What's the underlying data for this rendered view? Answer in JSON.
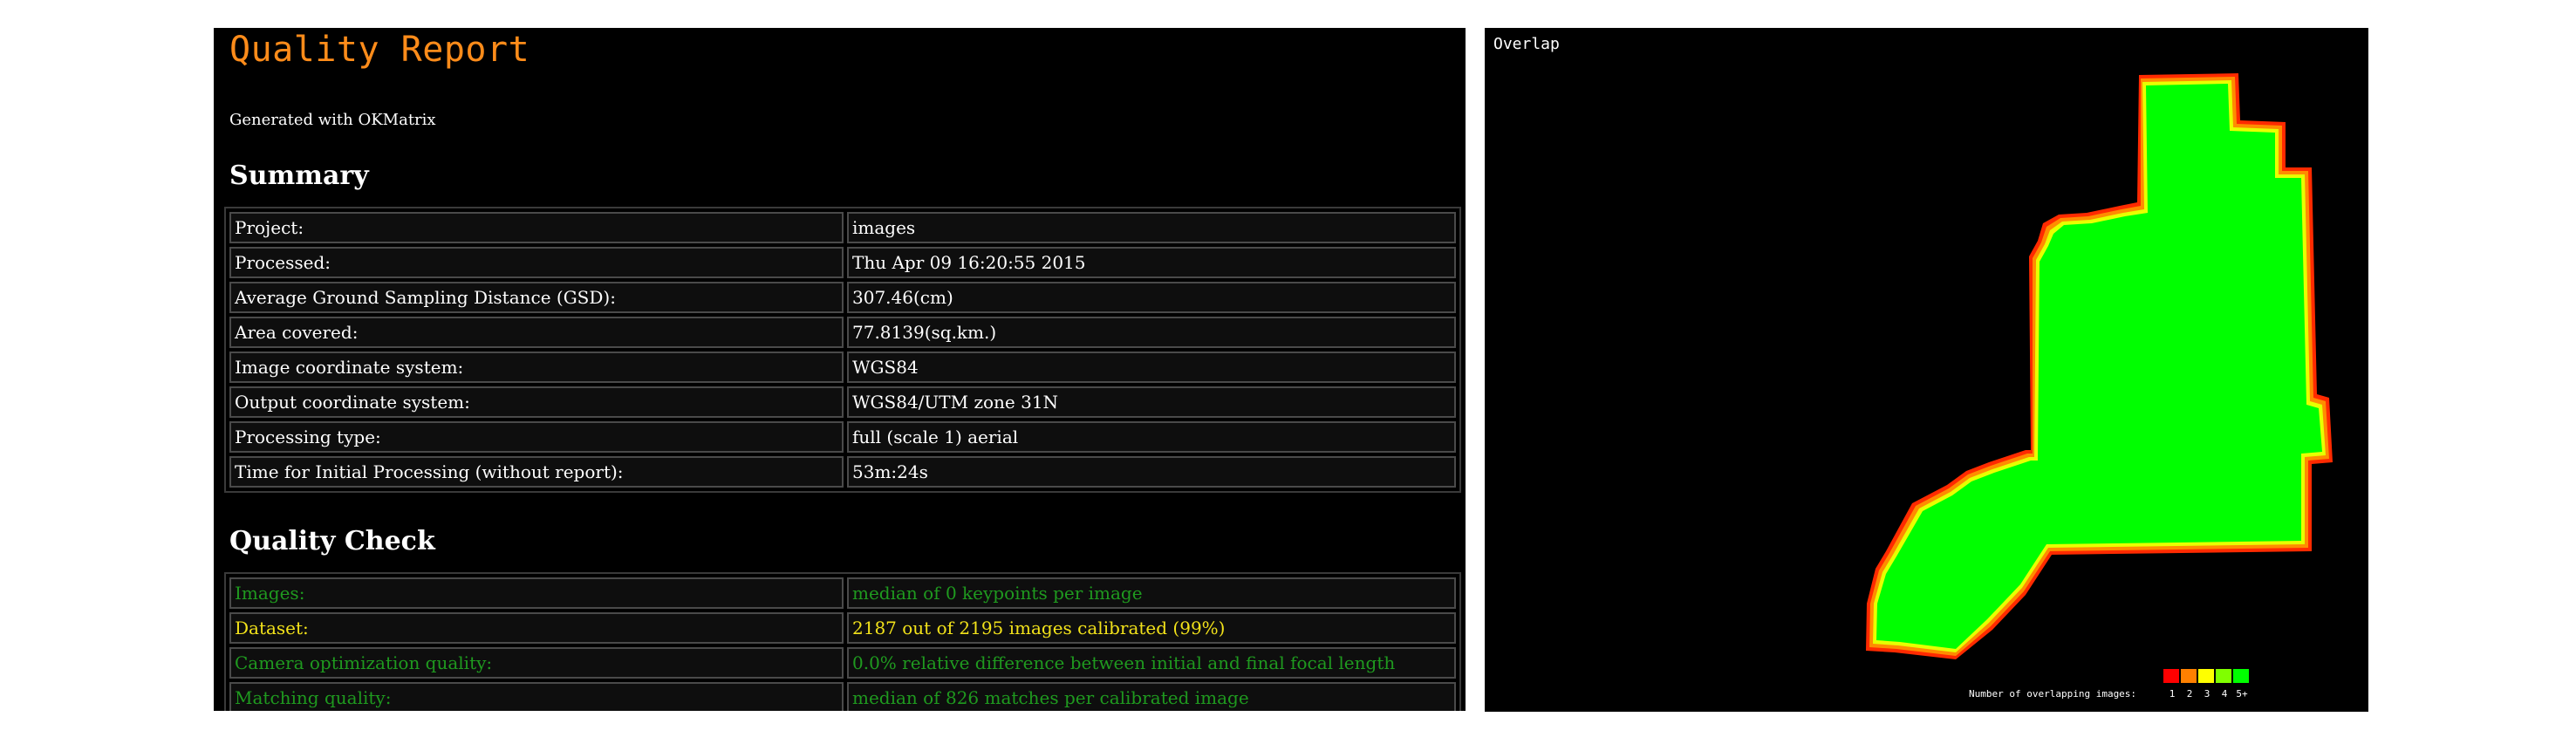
{
  "report": {
    "title": "Quality Report",
    "generated": "Generated with OKMatrix",
    "summary_heading": "Summary",
    "summary_rows": [
      {
        "key": "Project:",
        "value": "images"
      },
      {
        "key": "Processed:",
        "value": "Thu Apr 09 16:20:55 2015"
      },
      {
        "key": "Average Ground Sampling Distance (GSD):",
        "value": "307.46(cm)"
      },
      {
        "key": "Area covered:",
        "value": "77.8139(sq.km.)"
      },
      {
        "key": "Image coordinate system:",
        "value": "WGS84"
      },
      {
        "key": "Output coordinate system:",
        "value": "WGS84/UTM zone 31N"
      },
      {
        "key": "Processing type:",
        "value": "full (scale 1) aerial"
      },
      {
        "key": "Time for Initial Processing (without report):",
        "value": "53m:24s"
      }
    ],
    "quality_heading": "Quality Check",
    "quality_rows": [
      {
        "key": "Images:",
        "value": "median of 0 keypoints per image"
      },
      {
        "key": "Dataset:",
        "value": "2187 out of 2195 images calibrated (99%)"
      },
      {
        "key": "Camera optimization quality:",
        "value": "0.0% relative difference between initial and final focal length"
      },
      {
        "key": "Matching quality:",
        "value": "median of 826 matches per calibrated image"
      }
    ]
  },
  "overlap": {
    "title": "Overlap",
    "legend_label": "Number of overlapping images:",
    "legend_values": [
      "1",
      "2",
      "3",
      "4",
      "5+"
    ],
    "legend_colors": [
      "#ff0000",
      "#ff8000",
      "#ffff00",
      "#80ff00",
      "#00ff00"
    ]
  },
  "colors": {
    "title_orange": "#ff8c1a",
    "quality_green": "#1f9a1f",
    "quality_yellow": "#f2e21a",
    "overlap_green": "#00ff00"
  }
}
